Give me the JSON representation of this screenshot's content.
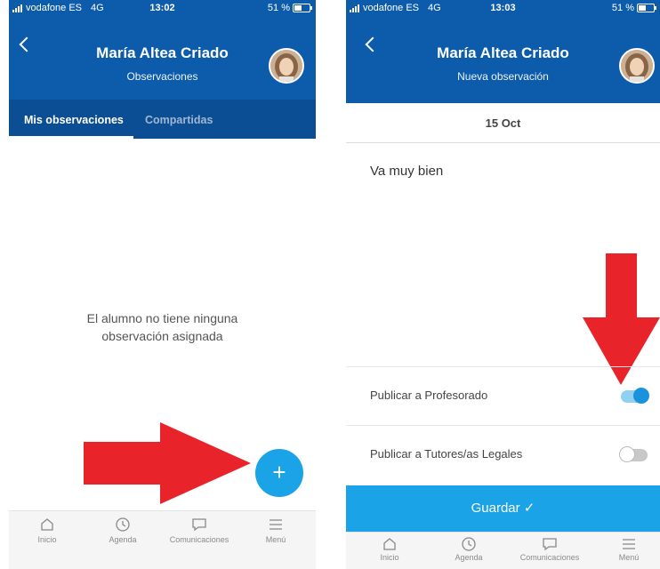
{
  "left": {
    "status": {
      "carrier": "vodafone ES",
      "network": "4G",
      "time": "13:02",
      "battery": "51 %",
      "battery_level": 0.51
    },
    "header": {
      "title": "María Altea Criado",
      "subtitle": "Observaciones"
    },
    "tabs": [
      {
        "label": "Mis observaciones",
        "active": true
      },
      {
        "label": "Compartidas",
        "active": false
      }
    ],
    "empty_message_line1": "El alumno no tiene ninguna",
    "empty_message_line2": "observación asignada",
    "fab_label": "+",
    "nav": [
      {
        "label": "Inicio",
        "icon": "home-icon"
      },
      {
        "label": "Agenda",
        "icon": "clock-icon"
      },
      {
        "label": "Comunicaciones",
        "icon": "chat-icon"
      },
      {
        "label": "Menú",
        "icon": "menu-icon"
      }
    ]
  },
  "right": {
    "status": {
      "carrier": "vodafone ES",
      "network": "4G",
      "time": "13:03",
      "battery": "51 %",
      "battery_level": 0.51
    },
    "header": {
      "title": "María Altea Criado",
      "subtitle": "Nueva observación"
    },
    "date": "15 Oct",
    "observation_text": "Va muy bien",
    "options": [
      {
        "label": "Publicar a Profesorado",
        "on": true
      },
      {
        "label": "Publicar a Tutores/as Legales",
        "on": false
      }
    ],
    "save_label": "Guardar  ✓",
    "nav": [
      {
        "label": "Inicio",
        "icon": "home-icon"
      },
      {
        "label": "Agenda",
        "icon": "clock-icon"
      },
      {
        "label": "Comunicaciones",
        "icon": "chat-icon"
      },
      {
        "label": "Menú",
        "icon": "menu-icon"
      }
    ]
  },
  "colors": {
    "header_blue": "#0d5cab",
    "tabs_blue": "#0c4e93",
    "accent": "#1aa3e6",
    "arrow_red": "#e8232a"
  }
}
